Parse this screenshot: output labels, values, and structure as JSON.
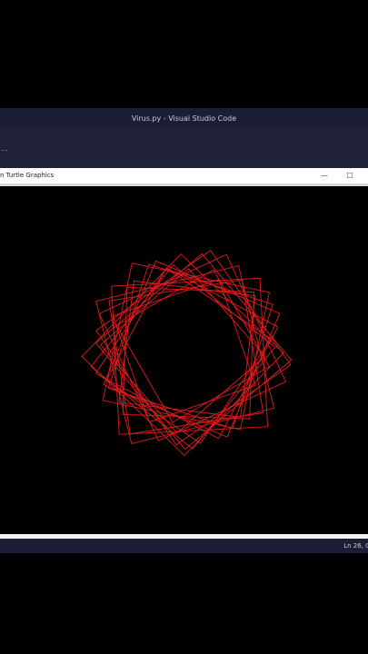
{
  "vscode": {
    "window_title": "Virus.py - Visual Studio Code",
    "toolbar_overflow": "...",
    "status_position": "Ln 26, C"
  },
  "turtle_window": {
    "title": "n Turtle Graphics",
    "minimize_symbol": "—",
    "maximize_symbol": "☐"
  },
  "drawing": {
    "stroke_color": "#e01b1b",
    "background": "#000000",
    "shape": "square",
    "square_count": 18
  }
}
